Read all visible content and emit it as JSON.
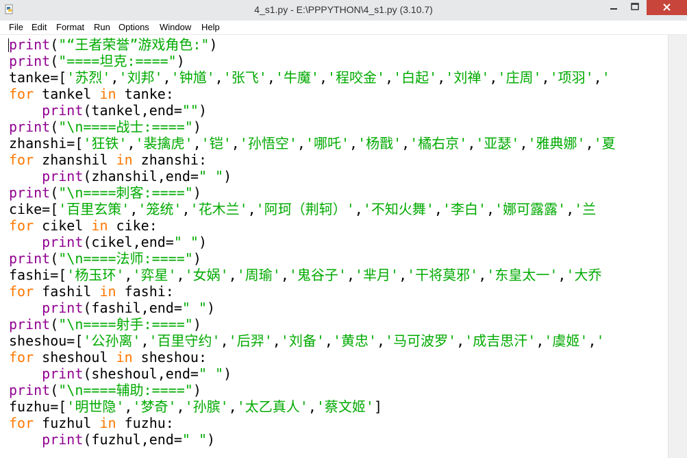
{
  "window": {
    "title": "4_s1.py - E:\\PPPYTHON\\4_s1.py (3.10.7)"
  },
  "menu": [
    "File",
    "Edit",
    "Format",
    "Run",
    "Options",
    "Window",
    "Help"
  ],
  "code": [
    [
      [
        "bi",
        "print"
      ],
      [
        "",
        "("
      ],
      [
        "str",
        "\"“王者荣誉”游戏角色:\""
      ],
      [
        "",
        ")"
      ]
    ],
    [
      [
        "bi",
        "print"
      ],
      [
        "",
        "("
      ],
      [
        "str",
        "\"====坦克:====\""
      ],
      [
        "",
        ")"
      ]
    ],
    [
      [
        "",
        "tanke=["
      ],
      [
        "str",
        "'苏烈'"
      ],
      [
        "",
        ","
      ],
      [
        "str",
        "'刘邦'"
      ],
      [
        "",
        ","
      ],
      [
        "str",
        "'钟馗'"
      ],
      [
        "",
        ","
      ],
      [
        "str",
        "'张飞'"
      ],
      [
        "",
        ","
      ],
      [
        "str",
        "'牛魔'"
      ],
      [
        "",
        ","
      ],
      [
        "str",
        "'程咬金'"
      ],
      [
        "",
        ","
      ],
      [
        "str",
        "'白起'"
      ],
      [
        "",
        ","
      ],
      [
        "str",
        "'刘禅'"
      ],
      [
        "",
        ","
      ],
      [
        "str",
        "'庄周'"
      ],
      [
        "",
        ","
      ],
      [
        "str",
        "'项羽'"
      ],
      [
        "",
        ","
      ],
      [
        "str",
        "'"
      ]
    ],
    [
      [
        "kw",
        "for"
      ],
      [
        "",
        " tankel "
      ],
      [
        "kw",
        "in"
      ],
      [
        "",
        " tanke:"
      ]
    ],
    [
      [
        "",
        "    "
      ],
      [
        "bi",
        "print"
      ],
      [
        "",
        "(tankel,end="
      ],
      [
        "str",
        "\"\""
      ],
      [
        "",
        ")"
      ]
    ],
    [
      [
        "bi",
        "print"
      ],
      [
        "",
        "("
      ],
      [
        "str",
        "\"\\n====战士:====\""
      ],
      [
        "",
        ")"
      ]
    ],
    [
      [
        "",
        "zhanshi=["
      ],
      [
        "str",
        "'狂铁'"
      ],
      [
        "",
        ","
      ],
      [
        "str",
        "'裴擒虎'"
      ],
      [
        "",
        ","
      ],
      [
        "str",
        "'铠'"
      ],
      [
        "",
        ","
      ],
      [
        "str",
        "'孙悟空'"
      ],
      [
        "",
        ","
      ],
      [
        "str",
        "'哪吒'"
      ],
      [
        "",
        ","
      ],
      [
        "str",
        "'杨戬'"
      ],
      [
        "",
        ","
      ],
      [
        "str",
        "'橘右京'"
      ],
      [
        "",
        ","
      ],
      [
        "str",
        "'亚瑟'"
      ],
      [
        "",
        ","
      ],
      [
        "str",
        "'雅典娜'"
      ],
      [
        "",
        ","
      ],
      [
        "str",
        "'夏"
      ]
    ],
    [
      [
        "kw",
        "for"
      ],
      [
        "",
        " zhanshil "
      ],
      [
        "kw",
        "in"
      ],
      [
        "",
        " zhanshi:"
      ]
    ],
    [
      [
        "",
        "    "
      ],
      [
        "bi",
        "print"
      ],
      [
        "",
        "(zhanshil,end="
      ],
      [
        "str",
        "\" \""
      ],
      [
        "",
        ")"
      ]
    ],
    [
      [
        "bi",
        "print"
      ],
      [
        "",
        "("
      ],
      [
        "str",
        "\"\\n====刺客:====\""
      ],
      [
        "",
        ")"
      ]
    ],
    [
      [
        "",
        "cike=["
      ],
      [
        "str",
        "'百里玄策'"
      ],
      [
        "",
        ","
      ],
      [
        "str",
        "'笼统'"
      ],
      [
        "",
        ","
      ],
      [
        "str",
        "'花木兰'"
      ],
      [
        "",
        ","
      ],
      [
        "str",
        "'阿珂（荆轲）'"
      ],
      [
        "",
        ","
      ],
      [
        "str",
        "'不知火舞'"
      ],
      [
        "",
        ","
      ],
      [
        "str",
        "'李白'"
      ],
      [
        "",
        ","
      ],
      [
        "str",
        "'娜可露露'"
      ],
      [
        "",
        ","
      ],
      [
        "str",
        "'兰"
      ]
    ],
    [
      [
        "kw",
        "for"
      ],
      [
        "",
        " cikel "
      ],
      [
        "kw",
        "in"
      ],
      [
        "",
        " cike:"
      ]
    ],
    [
      [
        "",
        "    "
      ],
      [
        "bi",
        "print"
      ],
      [
        "",
        "(cikel,end="
      ],
      [
        "str",
        "\" \""
      ],
      [
        "",
        ")"
      ]
    ],
    [
      [
        "bi",
        "print"
      ],
      [
        "",
        "("
      ],
      [
        "str",
        "\"\\n====法师:====\""
      ],
      [
        "",
        ")"
      ]
    ],
    [
      [
        "",
        "fashi=["
      ],
      [
        "str",
        "'杨玉环'"
      ],
      [
        "",
        ","
      ],
      [
        "str",
        "'弈星'"
      ],
      [
        "",
        ","
      ],
      [
        "str",
        "'女娲'"
      ],
      [
        "",
        ","
      ],
      [
        "str",
        "'周瑜'"
      ],
      [
        "",
        ","
      ],
      [
        "str",
        "'鬼谷子'"
      ],
      [
        "",
        ","
      ],
      [
        "str",
        "'芈月'"
      ],
      [
        "",
        ","
      ],
      [
        "str",
        "'干将莫邪'"
      ],
      [
        "",
        ","
      ],
      [
        "str",
        "'东皇太一'"
      ],
      [
        "",
        ","
      ],
      [
        "str",
        "'大乔"
      ]
    ],
    [
      [
        "kw",
        "for"
      ],
      [
        "",
        " fashil "
      ],
      [
        "kw",
        "in"
      ],
      [
        "",
        " fashi:"
      ]
    ],
    [
      [
        "",
        "    "
      ],
      [
        "bi",
        "print"
      ],
      [
        "",
        "(fashil,end="
      ],
      [
        "str",
        "\" \""
      ],
      [
        "",
        ")"
      ]
    ],
    [
      [
        "bi",
        "print"
      ],
      [
        "",
        "("
      ],
      [
        "str",
        "\"\\n====射手:====\""
      ],
      [
        "",
        ")"
      ]
    ],
    [
      [
        "",
        "sheshou=["
      ],
      [
        "str",
        "'公孙离'"
      ],
      [
        "",
        ","
      ],
      [
        "str",
        "'百里守约'"
      ],
      [
        "",
        ","
      ],
      [
        "str",
        "'后羿'"
      ],
      [
        "",
        ","
      ],
      [
        "str",
        "'刘备'"
      ],
      [
        "",
        ","
      ],
      [
        "str",
        "'黄忠'"
      ],
      [
        "",
        ","
      ],
      [
        "str",
        "'马可波罗'"
      ],
      [
        "",
        ","
      ],
      [
        "str",
        "'成吉思汗'"
      ],
      [
        "",
        ","
      ],
      [
        "str",
        "'虞姬'"
      ],
      [
        "",
        ","
      ],
      [
        "str",
        "'"
      ]
    ],
    [
      [
        "kw",
        "for"
      ],
      [
        "",
        " sheshoul "
      ],
      [
        "kw",
        "in"
      ],
      [
        "",
        " sheshou:"
      ]
    ],
    [
      [
        "",
        "    "
      ],
      [
        "bi",
        "print"
      ],
      [
        "",
        "(sheshoul,end="
      ],
      [
        "str",
        "\" \""
      ],
      [
        "",
        ")"
      ]
    ],
    [
      [
        "bi",
        "print"
      ],
      [
        "",
        "("
      ],
      [
        "str",
        "\"\\n====辅助:====\""
      ],
      [
        "",
        ")"
      ]
    ],
    [
      [
        "",
        "fuzhu=["
      ],
      [
        "str",
        "'明世隐'"
      ],
      [
        "",
        ","
      ],
      [
        "str",
        "'梦奇'"
      ],
      [
        "",
        ","
      ],
      [
        "str",
        "'孙膑'"
      ],
      [
        "",
        ","
      ],
      [
        "str",
        "'太乙真人'"
      ],
      [
        "",
        ","
      ],
      [
        "str",
        "'蔡文姬'"
      ],
      [
        "",
        "]"
      ]
    ],
    [
      [
        "kw",
        "for"
      ],
      [
        "",
        " fuzhul "
      ],
      [
        "kw",
        "in"
      ],
      [
        "",
        " fuzhu:"
      ]
    ],
    [
      [
        "",
        "    "
      ],
      [
        "bi",
        "print"
      ],
      [
        "",
        "(fuzhul,end="
      ],
      [
        "str",
        "\" \""
      ],
      [
        "",
        ")"
      ]
    ]
  ]
}
